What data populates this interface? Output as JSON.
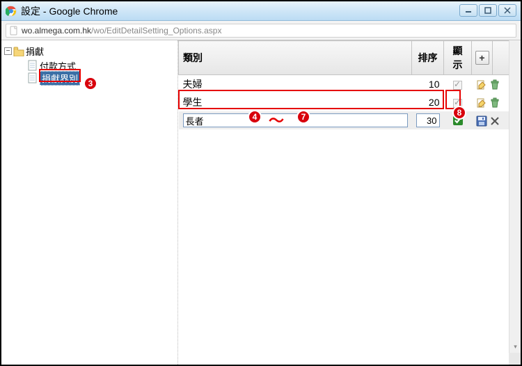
{
  "window": {
    "title": "設定 - Google Chrome"
  },
  "address": {
    "host": "wo.almega.com.hk",
    "path": "/wo/EditDetailSetting_Options.aspx"
  },
  "sidebar": {
    "root_label": "捐獻",
    "items": [
      {
        "label": "付款方式",
        "selected": false
      },
      {
        "label": "捐獻界別",
        "selected": true
      }
    ]
  },
  "table": {
    "headers": {
      "category": "類別",
      "sort": "排序",
      "show": "顯示"
    },
    "add_button": "+",
    "rows": [
      {
        "category": "夫婦",
        "sort": "10",
        "show": true,
        "mode": "view"
      },
      {
        "category": "學生",
        "sort": "20",
        "show": true,
        "mode": "view"
      },
      {
        "category": "長者",
        "sort": "30",
        "show": true,
        "mode": "edit"
      }
    ]
  },
  "annotations": {
    "n3": "3",
    "n4": "4",
    "n7": "7",
    "n8": "8",
    "tilde": "〜"
  }
}
